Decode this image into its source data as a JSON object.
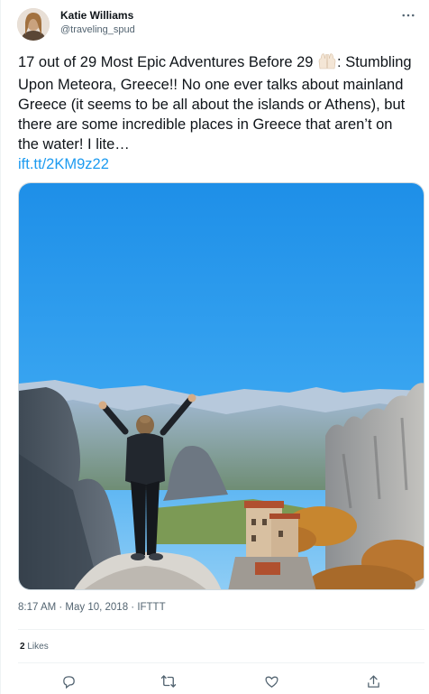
{
  "author": {
    "name": "Katie Williams",
    "handle": "@traveling_spud"
  },
  "tweet": {
    "text_before_emoji": "17 out of 29 Most Epic Adventures Before 29 ",
    "emoji": "raising-hands",
    "text_after_emoji": ": Stumbling Upon Meteora, Greece!! No one ever talks about mainland Greece (it seems to be all about the islands or Athens), but there are some incredible places in Greece that aren’t on the water! I lite…",
    "link_text": "ift.tt/2KM9z22"
  },
  "meta": {
    "timestamp": "8:17 AM · May 10, 2018 · IFTTT"
  },
  "stats": {
    "likes_count": "2",
    "likes_label": "Likes"
  },
  "colors": {
    "accent": "#1d9bf0",
    "text_secondary": "#536471"
  },
  "actions": [
    "reply-icon",
    "retweet-icon",
    "like-icon",
    "share-icon"
  ]
}
